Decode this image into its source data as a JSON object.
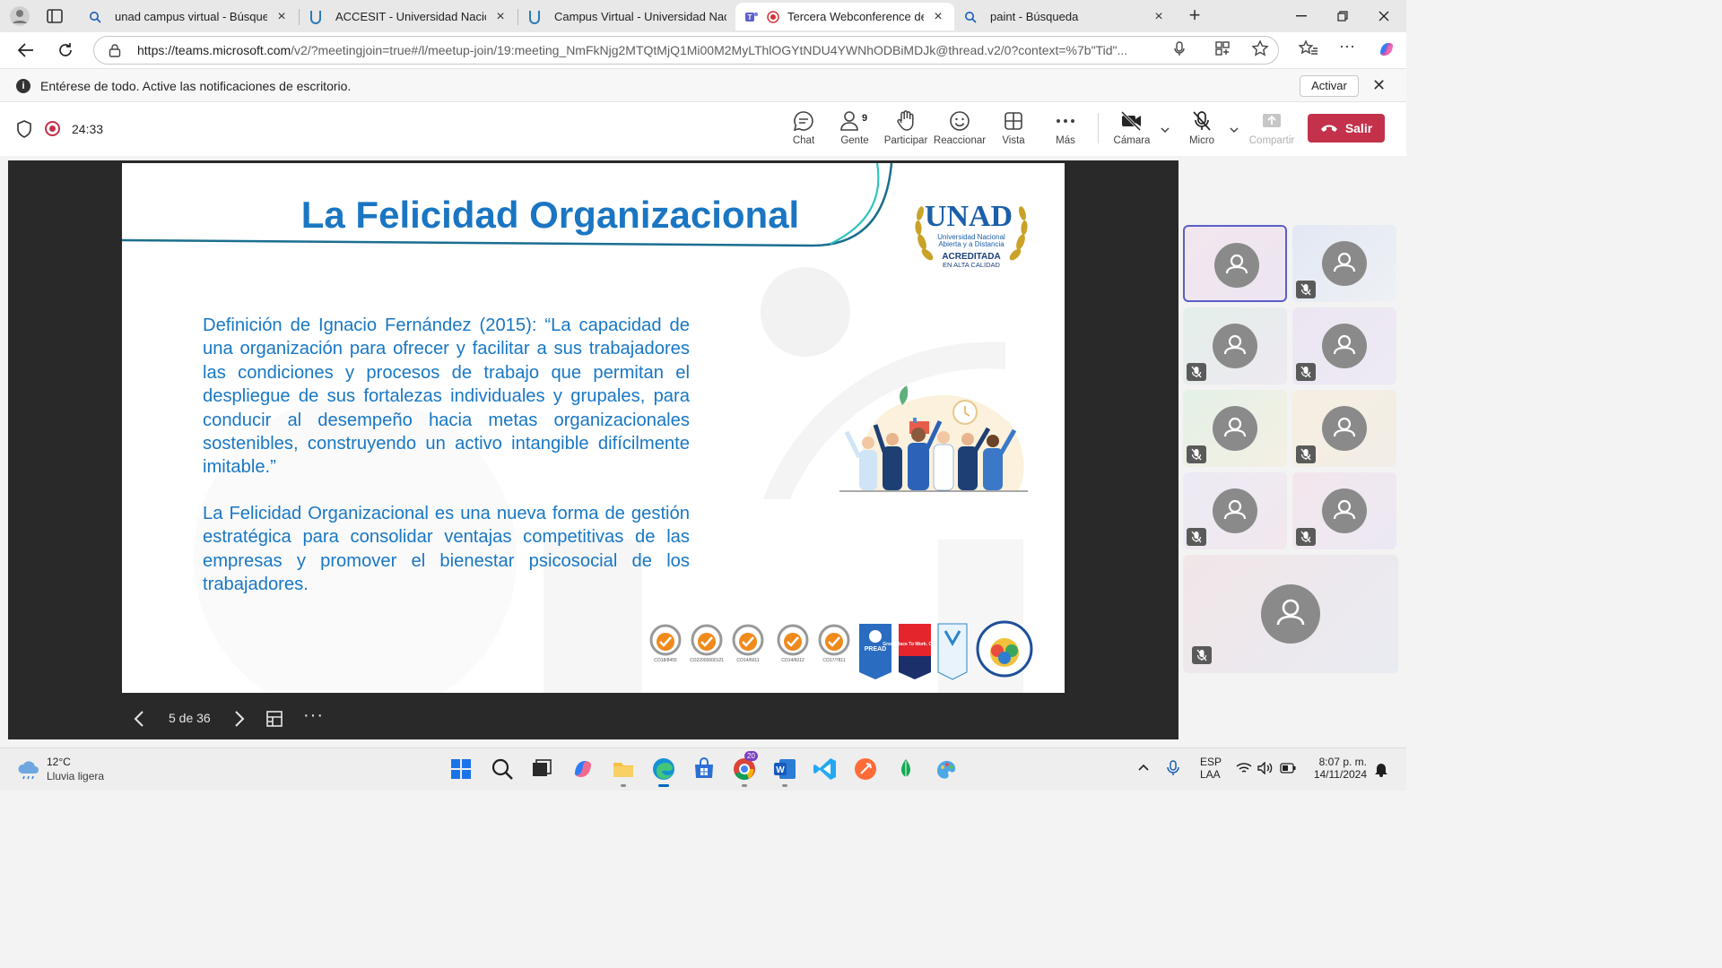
{
  "browser": {
    "tabs": [
      {
        "label": "unad campus virtual - Búsqueda",
        "icon": "search-icon"
      },
      {
        "label": "ACCESIT - Universidad Nacional A",
        "icon": "unad-icon"
      },
      {
        "label": "Campus Virtual - Universidad Nac",
        "icon": "unad-icon"
      },
      {
        "label": "Tercera Webconference de B",
        "icon": "teams-icon",
        "active": true
      },
      {
        "label": "paint - Búsqueda",
        "icon": "search-icon"
      }
    ],
    "url_host": "https://teams.microsoft.com",
    "url_rest": "/v2/?meetingjoin=true#/l/meetup-join/19:meeting_NmFkNjg2MTQtMjQ1Mi00M2MyLThlOGYtNDU4YWNhODBiMDJk@thread.v2/0?context=%7b\"Tid\"..."
  },
  "notification": {
    "message": "Entérese de todo. Active las notificaciones de escritorio.",
    "button": "Activar"
  },
  "meeting": {
    "timer": "24:33",
    "people_count": "9",
    "buttons": {
      "chat": "Chat",
      "people": "Gente",
      "raise": "Participar",
      "react": "Reaccionar",
      "view": "Vista",
      "more": "Más",
      "camera": "Cámara",
      "mic": "Micro",
      "share": "Compartir",
      "leave": "Salir"
    },
    "colors": {
      "leave": "#c4314b",
      "selected": "#5b5fc7"
    }
  },
  "slide": {
    "title": "La Felicidad Organizacional",
    "paragraph1": "Definición de Ignacio Fernández (2015): “La capacidad de una organización para ofrecer y facilitar a sus trabajadores las condiciones y procesos de trabajo que permitan el despliegue de sus fortalezas individuales y grupales, para conducir al desempeño hacia metas organizacionales sostenibles, construyendo un activo intangible difícilmente imitable.”",
    "paragraph2": "La Felicidad Organizacional es una nueva forma de gestión estratégica para consolidar ventajas competitivas de las empresas y promover el bienestar psicosocial de los trabajadores.",
    "logo": {
      "brand": "UNAD",
      "line1": "Universidad Nacional",
      "line2": "Abierta y a Distancia",
      "line3": "ACREDITADA",
      "line4": "EN ALTA CALIDAD"
    },
    "certs": [
      {
        "code": "CO18/8455"
      },
      {
        "code": "CO22000000121"
      },
      {
        "code": "CO14/6011"
      },
      {
        "code": "CO14/6012"
      },
      {
        "code": "CO17/7811"
      }
    ],
    "cert_badges": {
      "pread": "PREAD",
      "gptw": "Great Place To Work. Certified"
    },
    "page_indicator": "5 de 36",
    "color": "#1a76c2"
  },
  "participants": {
    "count_tiles": 9
  },
  "taskbar": {
    "weather_temp": "12°C",
    "weather_desc": "Lluvia ligera",
    "lang1": "ESP",
    "lang2": "LAA",
    "time": "8:07 p. m.",
    "date": "14/11/2024",
    "chrome_badge": "20"
  }
}
